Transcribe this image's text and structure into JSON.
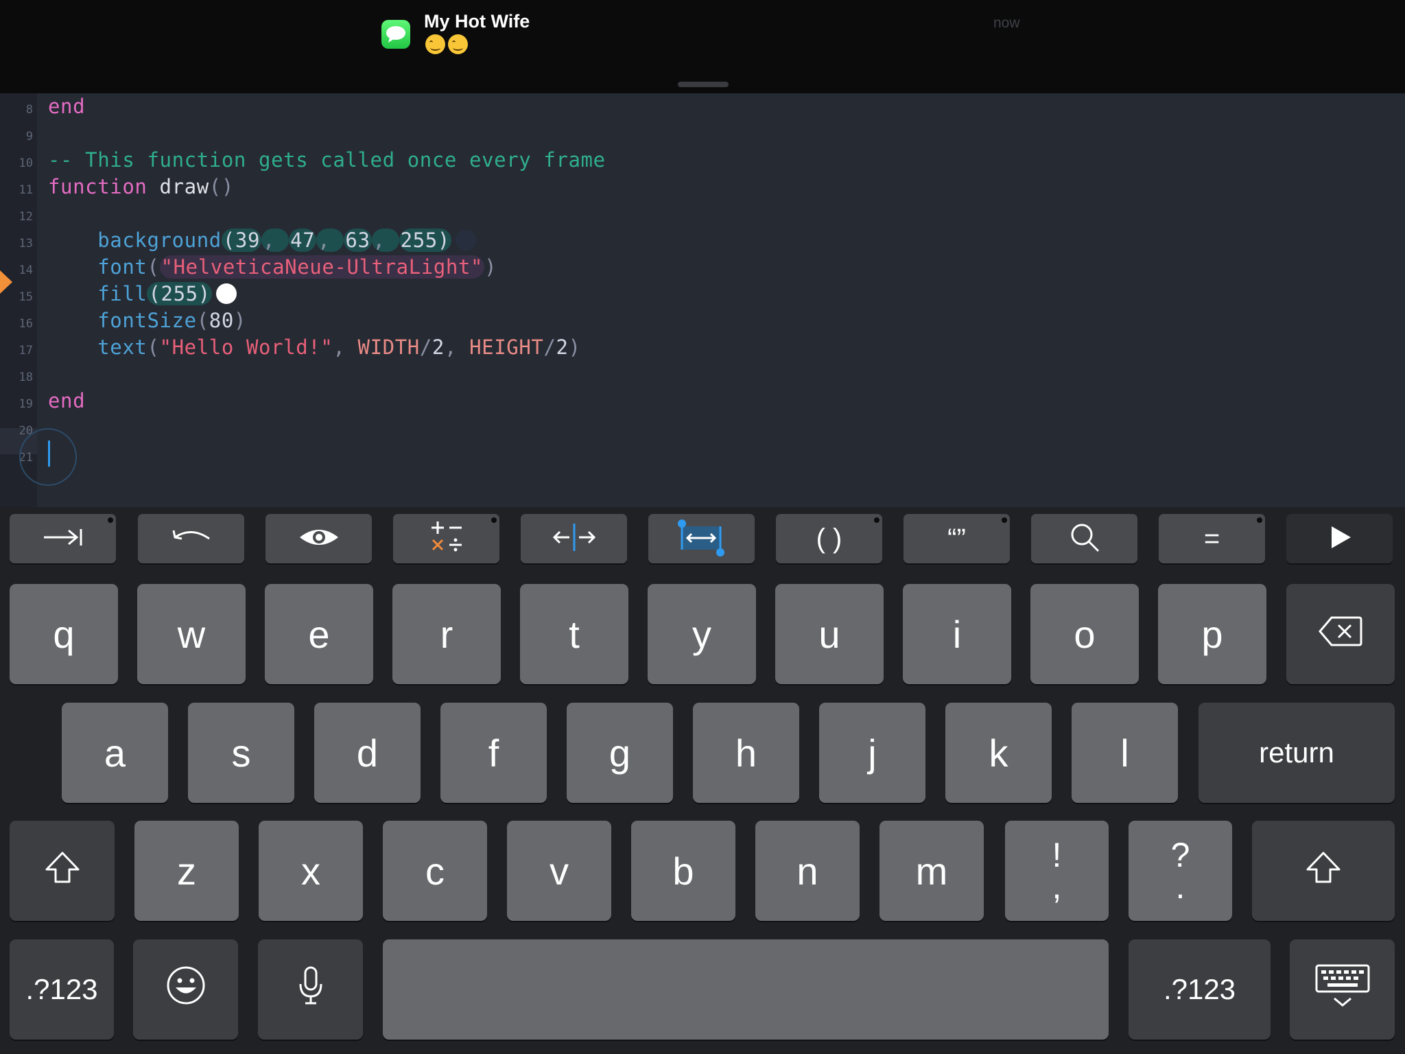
{
  "notification": {
    "sender": "My Hot Wife",
    "message_emoji": [
      "smiling-face-emoji",
      "smiling-face-emoji"
    ],
    "time": "now",
    "app_icon": "messages-icon"
  },
  "editor": {
    "lines": [
      {
        "n": "8",
        "segments": [
          {
            "t": "end",
            "c": "kw"
          }
        ]
      },
      {
        "n": "9",
        "segments": []
      },
      {
        "n": "10",
        "segments": [
          {
            "t": "-- This function gets called once every frame",
            "c": "cm"
          }
        ]
      },
      {
        "n": "11",
        "segments": [
          {
            "t": "function",
            "c": "kw"
          },
          {
            "t": " draw",
            "c": "pl"
          },
          {
            "t": "()",
            "c": "pn"
          }
        ]
      },
      {
        "n": "12",
        "segments": []
      },
      {
        "n": "13",
        "segments": [
          {
            "t": "    background",
            "c": "fn"
          },
          {
            "t": "(39",
            "c": "nm hl-num"
          },
          {
            "t": ", ",
            "c": "pn hl-num"
          },
          {
            "t": "47",
            "c": "nm hl-num"
          },
          {
            "t": ", ",
            "c": "pn hl-num"
          },
          {
            "t": "63",
            "c": "nm hl-num"
          },
          {
            "t": ", ",
            "c": "pn hl-num"
          },
          {
            "t": "255)",
            "c": "nm hl-num"
          },
          {
            "swatch": "#272f3f"
          }
        ]
      },
      {
        "n": "14",
        "segments": [
          {
            "t": "    font",
            "c": "fn"
          },
          {
            "t": "(",
            "c": "pn"
          },
          {
            "t": "\"HelveticaNeue-UltraLight\"",
            "c": "st hl-str"
          },
          {
            "t": ")",
            "c": "pn"
          }
        ]
      },
      {
        "n": "15",
        "segments": [
          {
            "t": "    fill",
            "c": "fn"
          },
          {
            "t": "(255)",
            "c": "nm hl-num"
          },
          {
            "swatch": "#ffffff"
          }
        ]
      },
      {
        "n": "16",
        "segments": [
          {
            "t": "    fontSize",
            "c": "fn"
          },
          {
            "t": "(",
            "c": "pn"
          },
          {
            "t": "80",
            "c": "nm"
          },
          {
            "t": ")",
            "c": "pn"
          }
        ]
      },
      {
        "n": "17",
        "segments": [
          {
            "t": "    text",
            "c": "fn"
          },
          {
            "t": "(",
            "c": "pn"
          },
          {
            "t": "\"Hello World!\"",
            "c": "st"
          },
          {
            "t": ", ",
            "c": "pn"
          },
          {
            "t": "WIDTH",
            "c": "cs"
          },
          {
            "t": "/",
            "c": "pn"
          },
          {
            "t": "2",
            "c": "nm"
          },
          {
            "t": ", ",
            "c": "pn"
          },
          {
            "t": "HEIGHT",
            "c": "cs"
          },
          {
            "t": "/",
            "c": "pn"
          },
          {
            "t": "2",
            "c": "nm"
          },
          {
            "t": ")",
            "c": "pn"
          }
        ]
      },
      {
        "n": "18",
        "segments": []
      },
      {
        "n": "19",
        "segments": [
          {
            "t": "end",
            "c": "kw"
          }
        ]
      },
      {
        "n": "20",
        "segments": []
      },
      {
        "n": "21",
        "segments": []
      }
    ]
  },
  "toolbar": [
    {
      "name": "tab-key-icon",
      "dot": true
    },
    {
      "name": "undo-icon",
      "dot": false
    },
    {
      "name": "eye-icon",
      "dot": false
    },
    {
      "name": "operators-icon",
      "dot": true
    },
    {
      "name": "split-cursor-icon",
      "dot": false
    },
    {
      "name": "select-range-icon",
      "dot": false
    },
    {
      "name": "parentheses-key",
      "label": "( )",
      "dot": true
    },
    {
      "name": "quotes-key",
      "label": "“”",
      "dot": true
    },
    {
      "name": "search-icon",
      "dot": false
    },
    {
      "name": "equals-key",
      "label": "=",
      "dot": true
    },
    {
      "name": "play-icon",
      "dot": false,
      "dark": true
    }
  ],
  "keyboard": {
    "row1": [
      "q",
      "w",
      "e",
      "r",
      "t",
      "y",
      "u",
      "i",
      "o",
      "p"
    ],
    "row2": [
      "a",
      "s",
      "d",
      "f",
      "g",
      "h",
      "j",
      "k",
      "l"
    ],
    "row3": [
      "z",
      "x",
      "c",
      "v",
      "b",
      "n",
      "m"
    ],
    "return_label": "return",
    "exclaim": {
      "top": "!",
      "bottom": ","
    },
    "question": {
      "top": "?",
      "bottom": "."
    },
    "numbers_label": ".?123",
    "numbers_label_right": ".?123"
  }
}
